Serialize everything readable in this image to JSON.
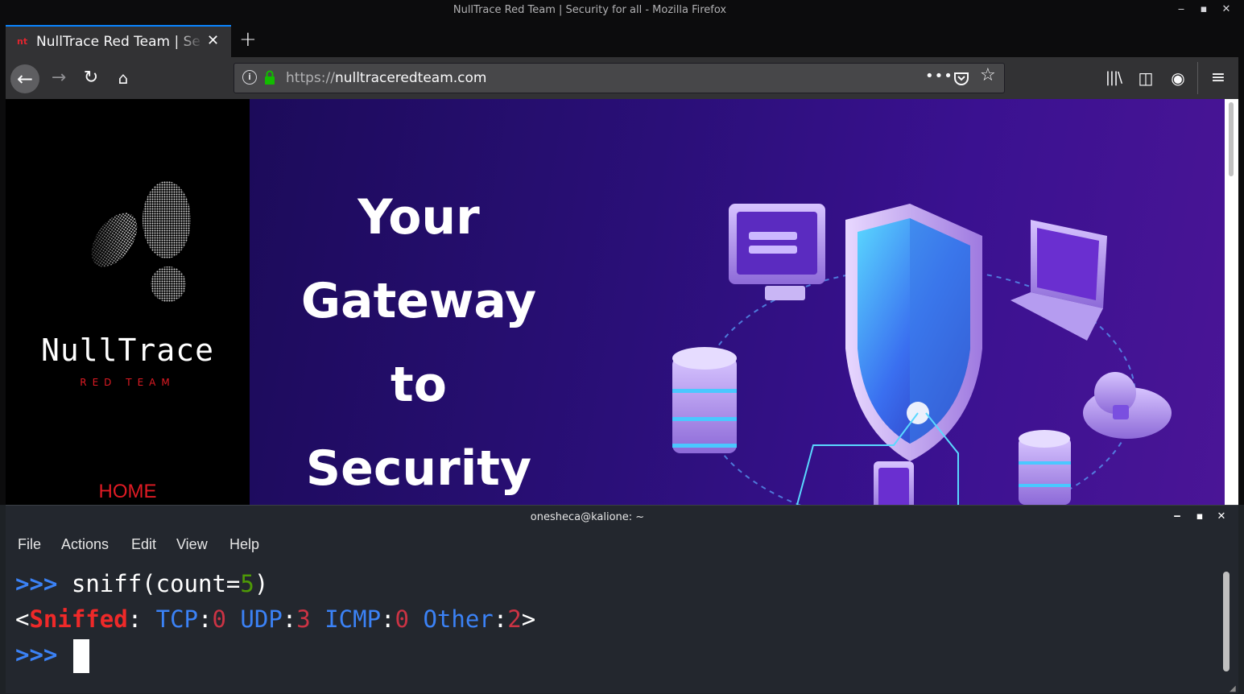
{
  "firefox": {
    "window_title": "NullTrace Red Team | Security for all - Mozilla Firefox",
    "controls": {
      "minimize": "‒",
      "maximize": "▪",
      "close": "✕"
    },
    "tab": {
      "favicon": "nt",
      "title": "NullTrace Red Team | Se",
      "close": "✕"
    },
    "new_tab": "+",
    "nav": {
      "back": "←",
      "forward": "→",
      "reload": "↻",
      "home": "⌂",
      "url_scheme": "https://",
      "url_host": "nulltraceredteam.com",
      "page_actions": "•••",
      "bookmark": "☆",
      "library": "|||\\",
      "sidebar": "◫",
      "account": "◉",
      "menu": "≡"
    }
  },
  "site": {
    "brand_name": "NullTrace",
    "brand_sub": "RED TEAM",
    "nav_home": "HOME",
    "hero_lines": [
      "Your",
      "Gateway",
      "to",
      "Security"
    ]
  },
  "terminal": {
    "title": "onesheca@kalione: ~",
    "controls": {
      "minimize": "‒",
      "maximize": "▪",
      "close": "✕"
    },
    "menu": [
      "File",
      "Actions",
      "Edit",
      "View",
      "Help"
    ],
    "line1": {
      "prompt": ">>>",
      "cmd_a": "sniff(count=",
      "cmd_num": "5",
      "cmd_b": ")"
    },
    "line2": {
      "lt": "<",
      "sniffed": "Sniffed",
      "colon": ": ",
      "tcp": "TCP",
      "tcp_v": "0",
      "udp": "UDP",
      "udp_v": "3",
      "icmp": "ICMP",
      "icmp_v": "0",
      "other": "Other",
      "other_v": "2",
      "gt": ">"
    },
    "line3": {
      "prompt": ">>>"
    }
  },
  "colors": {
    "firefox_accent": "#0a84ff",
    "brand_red": "#e01b24",
    "hero_purple": "#2a0f78",
    "prompt_blue": "#3b82f6",
    "number_green": "#4e9a06"
  }
}
